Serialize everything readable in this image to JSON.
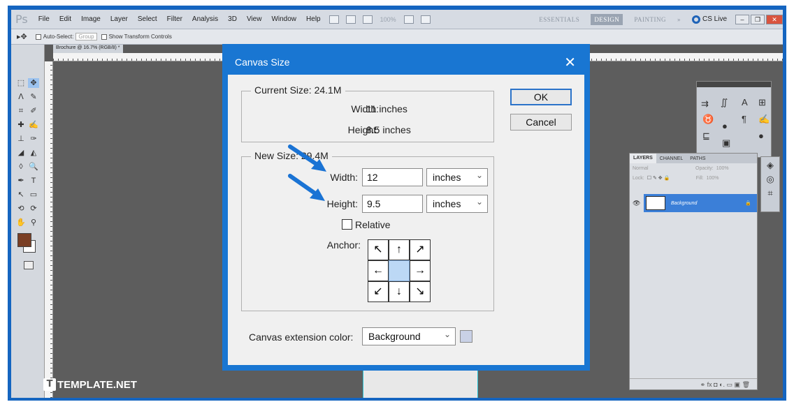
{
  "app": {
    "logo": "Ps",
    "menu": [
      "File",
      "Edit",
      "Image",
      "Layer",
      "Select",
      "Filter",
      "Analysis",
      "3D",
      "View",
      "Window",
      "Help"
    ],
    "zoom": "100%",
    "workspaces": [
      "ESSENTIALS",
      "DESIGN",
      "PAINTING",
      "»"
    ],
    "cslive": "CS Live"
  },
  "options_bar": {
    "auto_select": "Auto-Select:",
    "auto_select_value": "Group",
    "show_transform": "Show Transform Controls"
  },
  "document": {
    "tab": "Brochure @ 16.7% (RGB/8) *"
  },
  "layers_panel": {
    "tabs": [
      "LAYERS",
      "CHANNEL",
      "PATHS"
    ],
    "blend_mode": "Normal",
    "opacity_label": "Opacity:",
    "opacity": "100%",
    "lock_label": "Lock:",
    "fill_label": "Fill:",
    "fill": "100%",
    "layer_name": "Background",
    "footer_icons": "⚭ fx ◘ ◐. ▭ ▣ 🗑"
  },
  "dialog": {
    "title": "Canvas Size",
    "current_size_label": "Current Size: 24.1M",
    "current_width_label": "Width:",
    "current_width_value": "11 inches",
    "current_height_label": "Height:",
    "current_height_value": "8.5 inches",
    "new_size_label": "New Size: 29.4M",
    "width_label": "Width:",
    "width_value": "12",
    "width_unit": "inches",
    "height_label": "Height:",
    "height_value": "9.5",
    "height_unit": "inches",
    "relative_label": "Relative",
    "anchor_label": "Anchor:",
    "anchor_arrows": [
      "↖",
      "↑",
      "↗",
      "←",
      "",
      "→",
      "↙",
      "↓",
      "↘"
    ],
    "extension_label": "Canvas extension color:",
    "extension_value": "Background",
    "extension_swatch": "#c9d1e6",
    "ok_label": "OK",
    "cancel_label": "Cancel"
  },
  "watermark": {
    "logo": "T",
    "text": "TEMPLATE.NET"
  },
  "colors": {
    "accent": "#1976d2",
    "foreground_swatch": "#7a3f25",
    "selected_layer": "#3b7fd8"
  }
}
